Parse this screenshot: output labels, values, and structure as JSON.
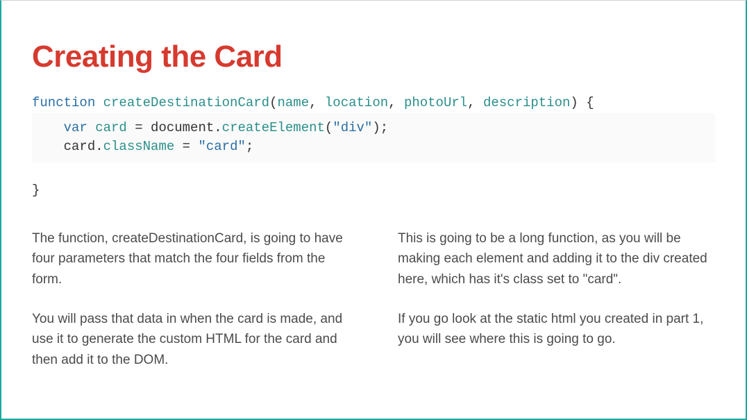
{
  "title": "Creating the Card",
  "code": {
    "l1": {
      "kw": "function ",
      "fn": "createDestinationCard",
      "open": "(",
      "p1": "name",
      "c1": ", ",
      "p2": "location",
      "c2": ", ",
      "p3": "photoUrl",
      "c3": ", ",
      "p4": "description",
      "close": ") {"
    },
    "l2": {
      "indent": "    ",
      "kw": "var ",
      "id1": "card",
      "eq": " = ",
      "obj": "document",
      "dot": ".",
      "meth": "createElement",
      "open": "(",
      "str": "\"div\"",
      "close": ");"
    },
    "l3": {
      "indent": "    ",
      "obj": "card",
      "dot": ".",
      "prop": "className",
      "eq": " = ",
      "str": "\"card\"",
      "semi": ";"
    },
    "l4": "}"
  },
  "left": {
    "p1": "The function, createDestinationCard, is going to have four parameters that match the four fields from the form.",
    "p2": "You will pass that data in when the card is made, and use it to generate the custom HTML for the card and then add it to the DOM."
  },
  "right": {
    "p1": "This is going to be a long function, as you will be making each element and adding it to the div created here, which has it's class set to \"card\".",
    "p2": "If you go look at the static html you created in part 1, you will see where this is going to go."
  }
}
